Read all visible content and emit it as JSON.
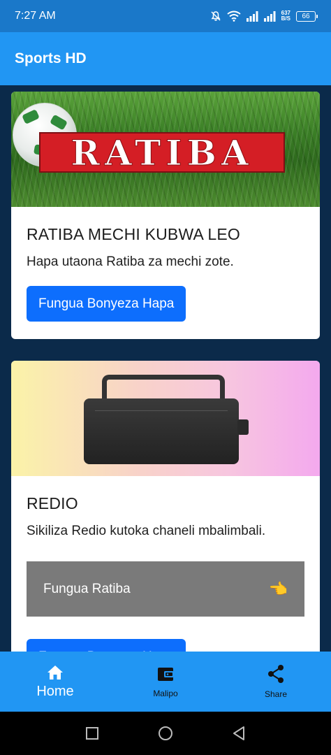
{
  "status_bar": {
    "time": "7:27 AM",
    "net_speed_value": "637",
    "net_speed_unit": "B/S",
    "battery": "66"
  },
  "app_bar": {
    "title": "Sports HD"
  },
  "cards": [
    {
      "banner_text": "RATIBA",
      "title": "RATIBA MECHI KUBWA LEO",
      "text": "Hapa utaona Ratiba za mechi zote.",
      "button_label": "Fungua Bonyeza Hapa"
    },
    {
      "title": "REDIO",
      "text": "Sikiliza Redio kutoka chaneli mbalimbali.",
      "row_label": "Fungua Ratiba",
      "row_icon": "pointing-hand-icon",
      "button_label": "Fungua Bonyeza Hapa"
    }
  ],
  "bottom_nav": {
    "items": [
      {
        "label": "Home",
        "icon": "home-icon"
      },
      {
        "label": "Malipo",
        "icon": "wallet-icon"
      },
      {
        "label": "Share",
        "icon": "share-icon"
      }
    ]
  },
  "colors": {
    "status_bar": "#1a78c9",
    "app_bar": "#2196f3",
    "background": "#0b2a4a",
    "primary_button": "#0d6efd",
    "grey_row": "#7a7a7a"
  }
}
